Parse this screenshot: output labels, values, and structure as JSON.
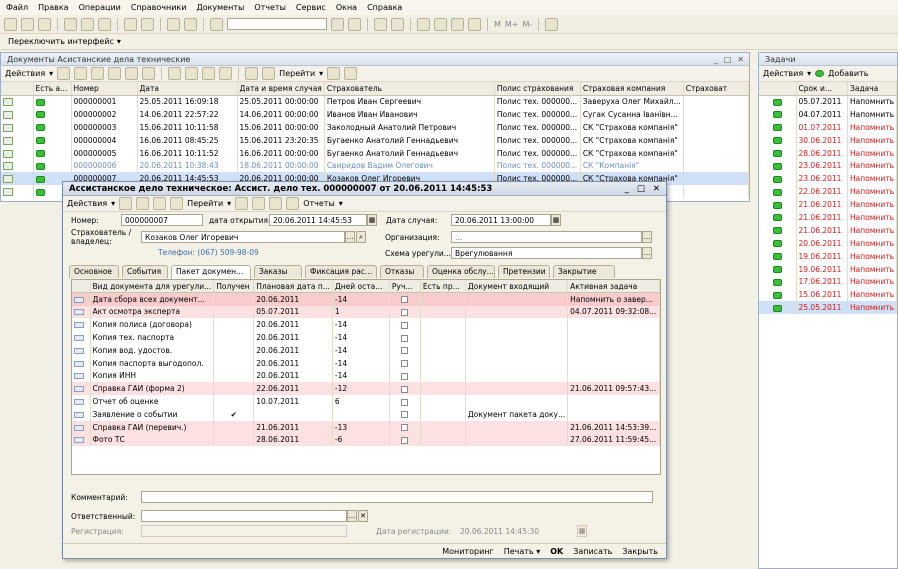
{
  "menu": [
    "Файл",
    "Правка",
    "Операции",
    "Справочники",
    "Документы",
    "Отчеты",
    "Сервис",
    "Окна",
    "Справка"
  ],
  "toolbar": {
    "mem": [
      "M",
      "M+",
      "M-"
    ]
  },
  "switch_label": "Переключить интерфейс",
  "docs": {
    "title": "Документы Асистанские дела технические",
    "actions": "Действия",
    "goto": "Перейти",
    "columns": [
      "Есть а...",
      "Номер",
      "Дата",
      "Дата и время случая",
      "Страхователь",
      "Полис страхования",
      "Страховая компания",
      "Страховат"
    ],
    "rows": [
      {
        "num": "000000001",
        "date": "25.05.2011 16:09:18",
        "case": "25.05.2011 00:00:00",
        "ins": "Петров Иван Сергеевич",
        "pol": "Полис тех. 000000...",
        "comp": "Заверуха Олег Михайл..."
      },
      {
        "num": "000000002",
        "date": "14.06.2011 22:57:22",
        "case": "14.06.2011 00:00:00",
        "ins": "Иванов Иван Иванович",
        "pol": "Полис тех. 000000...",
        "comp": "Сугак Сусанна Іванівн..."
      },
      {
        "num": "000000003",
        "date": "15.06.2011 10:11:58",
        "case": "15.06.2011 00:00:00",
        "ins": "Заколодный Анатолий Петрович",
        "pol": "Полис тех. 000000...",
        "comp": "СК \"Страхова компанія\""
      },
      {
        "num": "000000004",
        "date": "16.06.2011 08:45:25",
        "case": "15.06.2011 23:20:35",
        "ins": "Бугаенко Анатолий Геннадьевич",
        "pol": "Полис тех. 000000...",
        "comp": "СК \"Страхова компанія\""
      },
      {
        "num": "000000005",
        "date": "16.06.2011 10:11:52",
        "case": "16.06.2011 00:00:00",
        "ins": "Бугаенко Анатолий Геннадьевич",
        "pol": "Полис тех. 000000...",
        "comp": "СК \"Страхова компанія\""
      },
      {
        "num": "000000006",
        "date": "20.06.2011 10:38:43",
        "case": "18.06.2011 00:00:00",
        "ins": "Свиридов Вадим Олегович",
        "pol": "Полис тех. 000000...",
        "comp": "СК \"Компанія\""
      },
      {
        "num": "000000007",
        "date": "20.06.2011 14:45:53",
        "case": "20.06.2011 00:00:00",
        "ins": "Козаков Олег Игоревич",
        "pol": "Полис тех. 000000...",
        "comp": "СК \"Страхова компанія\""
      },
      {
        "num": "",
        "date": "",
        "case": "",
        "ins": "",
        "pol": "",
        "comp": ""
      }
    ]
  },
  "tasks": {
    "title": "Задачи",
    "actions": "Действия",
    "add": "Добавить",
    "columns": [
      "Срок и...",
      "Задача"
    ],
    "rows": [
      {
        "date": "05.07.2011",
        "task": "Напомнить"
      },
      {
        "date": "04.07.2011",
        "task": "Напомнить"
      },
      {
        "date": "01.07.2011",
        "task": "Напомнить"
      },
      {
        "date": "30.06.2011",
        "task": "Напомнить"
      },
      {
        "date": "28.06.2011",
        "task": "Напомнить"
      },
      {
        "date": "23.06.2011",
        "task": "Напомнить"
      },
      {
        "date": "23.06.2011",
        "task": "Напомнить"
      },
      {
        "date": "22.06.2011",
        "task": "Напомнить"
      },
      {
        "date": "21.06.2011",
        "task": "Напомнить"
      },
      {
        "date": "21.06.2011",
        "task": "Напомнить"
      },
      {
        "date": "21.06.2011",
        "task": "Напомнить"
      },
      {
        "date": "20.06.2011",
        "task": "Напомнить"
      },
      {
        "date": "19.06.2011",
        "task": "Напомнить"
      },
      {
        "date": "19.06.2011",
        "task": "Напомнить"
      },
      {
        "date": "17.06.2011",
        "task": "Напомнить"
      },
      {
        "date": "15.06.2011",
        "task": "Напомнить"
      },
      {
        "date": "25.05.2011",
        "task": "Напомнить"
      }
    ]
  },
  "dialog": {
    "title": "Ассистанское дело техническое: Ассист. дело тех. 000000007 от 20.06.2011 14:45:53",
    "actions": "Действия",
    "goto": "Перейти",
    "reports": "Отчеты",
    "number_label": "Номер:",
    "number": "000000007",
    "open_label": "дата открытия:",
    "open_date": "20.06.2011 14:45:53",
    "case_label": "Дата случая:",
    "case_date": "20.06.2011 13:00:00",
    "insurer_label": "Страхователь / владелец:",
    "insurer": "Козаков Олег Игоревич",
    "phone": "Телефон: (067) 509-98-09",
    "org_label": "Организация:",
    "org": "...",
    "scheme_label": "Схема урегули...",
    "scheme": "Врегулювання",
    "tabs": [
      "Основное",
      "События",
      "Пакет докумен...",
      "Заказы",
      "Фиксация рас...",
      "Отказы",
      "Оценка обслу...",
      "Претензии",
      "Закрытие"
    ],
    "grid_columns": [
      "Вид документа для урегули...",
      "Получен",
      "Плановая дата п...",
      "Дней оста...",
      "Руч...",
      "Есть пр...",
      "Документ входящий",
      "Активная задача"
    ],
    "grid_rows": [
      {
        "name": "Дата сбора всех документ...",
        "got": "",
        "plan": "20.06.2011",
        "days": "-14",
        "doc": "",
        "task": "Напомнить о завер..."
      },
      {
        "name": "Акт осмотра эксперта",
        "got": "",
        "plan": "05.07.2011",
        "days": "1",
        "doc": "",
        "task": "04.07.2011 09:32:08..."
      },
      {
        "name": "Копия полиса (договора)",
        "got": "",
        "plan": "20.06.2011",
        "days": "-14",
        "doc": "",
        "task": ""
      },
      {
        "name": "Копия тех. паспорта",
        "got": "",
        "plan": "20.06.2011",
        "days": "-14",
        "doc": "",
        "task": ""
      },
      {
        "name": "Копия вод. удостов.",
        "got": "",
        "plan": "20.06.2011",
        "days": "-14",
        "doc": "",
        "task": ""
      },
      {
        "name": "Копия паспорта выгодопол.",
        "got": "",
        "plan": "20.06.2011",
        "days": "-14",
        "doc": "",
        "task": ""
      },
      {
        "name": "Копия ИНН",
        "got": "",
        "plan": "20.06.2011",
        "days": "-14",
        "doc": "",
        "task": ""
      },
      {
        "name": "Справка ГАИ (форма 2)",
        "got": "",
        "plan": "22.06.2011",
        "days": "-12",
        "doc": "",
        "task": "21.06.2011 09:57:43..."
      },
      {
        "name": "Отчет об оценке",
        "got": "",
        "plan": "10.07.2011",
        "days": "6",
        "doc": "",
        "task": ""
      },
      {
        "name": "Заявление о событии",
        "got": "✔",
        "plan": "",
        "days": "",
        "doc": "Документ пакета доку...",
        "task": ""
      },
      {
        "name": "Справка ГАИ (перевич.)",
        "got": "",
        "plan": "21.06.2011",
        "days": "-13",
        "doc": "",
        "task": "21.06.2011 14:53:39..."
      },
      {
        "name": "Фото ТС",
        "got": "",
        "plan": "28.06.2011",
        "days": "-6",
        "doc": "",
        "task": "27.06.2011 11:59:45..."
      }
    ],
    "comment_label": "Комментарий:",
    "resp_label": "Ответственный:",
    "reg_label": "Регистрация:",
    "reg_date_label": "Дата регистрации:",
    "reg_date": "20.06.2011 14:45:30",
    "bottom": [
      "Мониторинг",
      "Печать",
      "OK",
      "Записать",
      "Закрыть"
    ]
  }
}
